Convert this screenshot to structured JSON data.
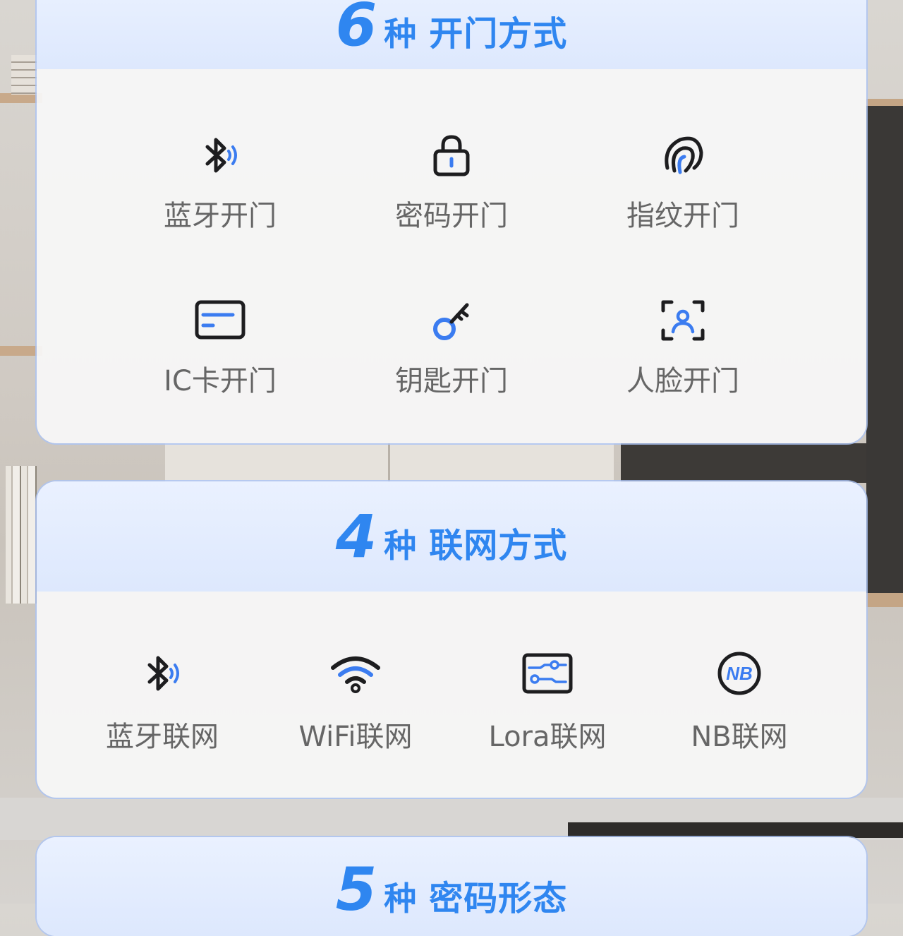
{
  "colors": {
    "accent": "#2f86f0",
    "icon_blue": "#3b7cf0",
    "icon_dark": "#1d1d1f",
    "label": "#666666"
  },
  "unlock_section": {
    "number": "6",
    "unit": "种",
    "title": "开门方式",
    "items": [
      {
        "icon": "bluetooth-icon",
        "label": "蓝牙开门"
      },
      {
        "icon": "lock-icon",
        "label": "密码开门"
      },
      {
        "icon": "fingerprint-icon",
        "label": "指纹开门"
      },
      {
        "icon": "card-icon",
        "label": "IC卡开门"
      },
      {
        "icon": "key-icon",
        "label": "钥匙开门"
      },
      {
        "icon": "face-scan-icon",
        "label": "人脸开门"
      }
    ]
  },
  "network_section": {
    "number": "4",
    "unit": "种",
    "title": "联网方式",
    "items": [
      {
        "icon": "bluetooth-icon",
        "label": "蓝牙联网"
      },
      {
        "icon": "wifi-icon",
        "label": "WiFi联网"
      },
      {
        "icon": "lora-icon",
        "label": "Lora联网"
      },
      {
        "icon": "nb-icon",
        "label": "NB联网",
        "badge": "NB"
      }
    ]
  },
  "password_section": {
    "number": "5",
    "unit": "种",
    "title": "密码形态"
  }
}
